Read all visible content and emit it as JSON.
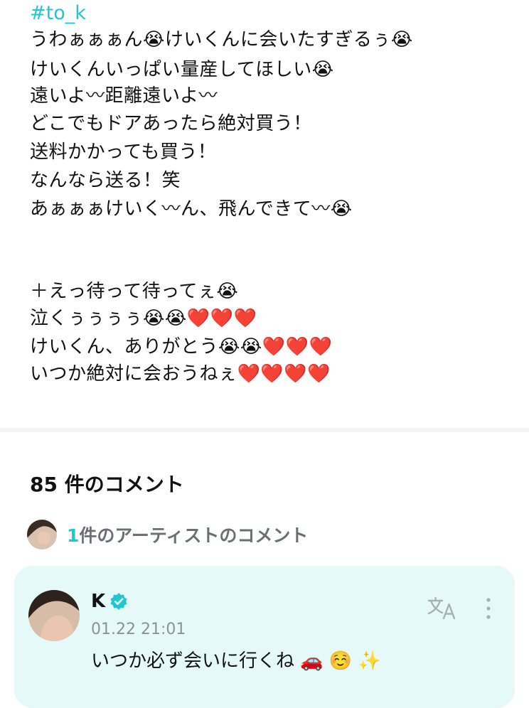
{
  "post": {
    "hashtag": "#to_k",
    "lines": [
      "うわぁぁぁん😭けいくんに会いたすぎるぅ😭",
      "けいくんいっぱい量産してほしい😭",
      "遠いよ〰距離遠いよ〰",
      "どこでもドアあったら絶対買う！",
      "送料かかっても買う！",
      "なんなら送る！笑",
      "あぁぁぁけいく〰ん、飛んできて〰😭",
      "",
      "",
      "＋えっ待って待ってぇ😭",
      "泣くぅぅぅぅ😭😭❤️❤️❤️",
      "けいくん、ありがとう😭😭❤️❤️❤️",
      "いつか絶対に会おうねぇ❤️❤️❤️❤️"
    ]
  },
  "comments_header": {
    "count_label": "85 件のコメント",
    "artist_count": "1",
    "artist_label": "件のアーティストのコメント"
  },
  "artist_comment": {
    "author": "K",
    "timestamp": "01.22 21:01",
    "text": "いつか必ず会いに行くね 🚗 ☺️ ✨"
  },
  "colors": {
    "accent": "#1fc8cf",
    "card_bg": "#e5faf8",
    "muted": "#8d9196"
  },
  "icons": [
    "crying-face-emoji",
    "red-heart-emoji",
    "verified-badge-icon",
    "translate-icon",
    "more-vertical-icon",
    "car-emoji",
    "smiling-face-emoji",
    "sparkles-emoji"
  ]
}
